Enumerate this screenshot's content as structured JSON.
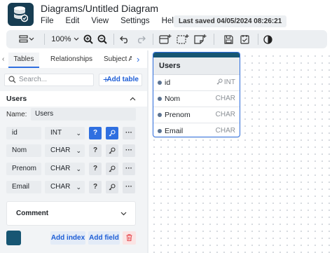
{
  "app": {
    "title": "Diagrams/Untitled Diagram",
    "menu": [
      "File",
      "Edit",
      "View",
      "Settings",
      "Help"
    ],
    "last_saved": "Last saved 04/05/2024 08:26:21"
  },
  "toolbar": {
    "zoom": "100%",
    "icons": [
      "layout-icon",
      "zoom-in-icon",
      "zoom-out-icon",
      "undo-icon",
      "redo-icon",
      "add-table-icon",
      "add-area-icon",
      "add-note-icon",
      "save-icon",
      "todo-icon",
      "theme-icon"
    ]
  },
  "sidebar": {
    "tabs": [
      "Tables",
      "Relationships",
      "Subject A"
    ],
    "search_placeholder": "Search...",
    "add_table_label": "Add table",
    "table": {
      "section_title": "Users",
      "name_label": "Name:",
      "name_value": "Users",
      "fields": [
        {
          "name": "id",
          "type": "INT",
          "primary": true
        },
        {
          "name": "Nom",
          "type": "CHAR",
          "primary": false
        },
        {
          "name": "Prenom",
          "type": "CHAR",
          "primary": false
        },
        {
          "name": "Email",
          "type": "CHAR",
          "primary": false
        }
      ],
      "comment_label": "Comment",
      "add_index_label": "Add index",
      "add_field_label": "Add field",
      "color": "#175673"
    }
  },
  "canvas": {
    "card": {
      "title": "Users",
      "rows": [
        {
          "name": "id",
          "type": "INT",
          "key": true
        },
        {
          "name": "Nom",
          "type": "CHAR",
          "key": false
        },
        {
          "name": "Prenom",
          "type": "CHAR",
          "key": false
        },
        {
          "name": "Email",
          "type": "CHAR",
          "key": false
        }
      ]
    }
  },
  "colors": {
    "accent": "#2f6fe0",
    "brand": "#173d52",
    "table_header": "#175673"
  }
}
